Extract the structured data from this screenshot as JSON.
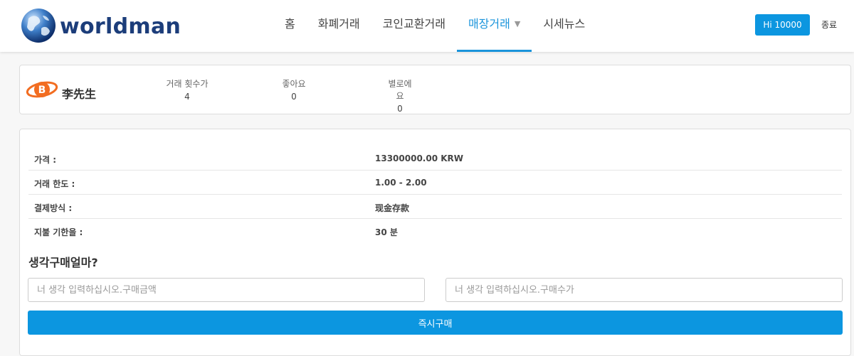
{
  "brand": {
    "name": "worldman"
  },
  "nav": {
    "items": [
      {
        "label": "홈"
      },
      {
        "label": "화폐거래"
      },
      {
        "label": "코인교환거래"
      },
      {
        "label": "매장거래"
      },
      {
        "label": "시세뉴스"
      }
    ],
    "active_index": 3
  },
  "user": {
    "greeting": "Hi 10000",
    "logout_label": "종료"
  },
  "seller": {
    "name": "李先生",
    "stats": [
      {
        "label": "거래 횟수가",
        "value": "4"
      },
      {
        "label": "좋아요",
        "value": "0"
      },
      {
        "label": "별로에요",
        "value": "0"
      }
    ]
  },
  "details": [
    {
      "label": "가격 :",
      "value": "13300000.00 KRW"
    },
    {
      "label": "거래 한도 :",
      "value": "1.00 - 2.00"
    },
    {
      "label": "결제방식 :",
      "value": "现金存款"
    },
    {
      "label": "지불 기한을 :",
      "value": "30 분"
    }
  ],
  "purchase": {
    "heading": "생각구매얼마?",
    "amount_placeholder": "너 생각 입력하십시오.구매금액",
    "quantity_placeholder": "너 생각 입력하십시오.구매수가",
    "buy_label": "즉시구매"
  },
  "colors": {
    "accent": "#0c96e0",
    "brand_text": "#1c3d7a",
    "seller_logo": "#f26d21"
  },
  "icons": {
    "brand_logo": "globe-icon",
    "seller_logo": "bitcoin-orbit-icon",
    "dropdown": "chevron-down-icon"
  }
}
